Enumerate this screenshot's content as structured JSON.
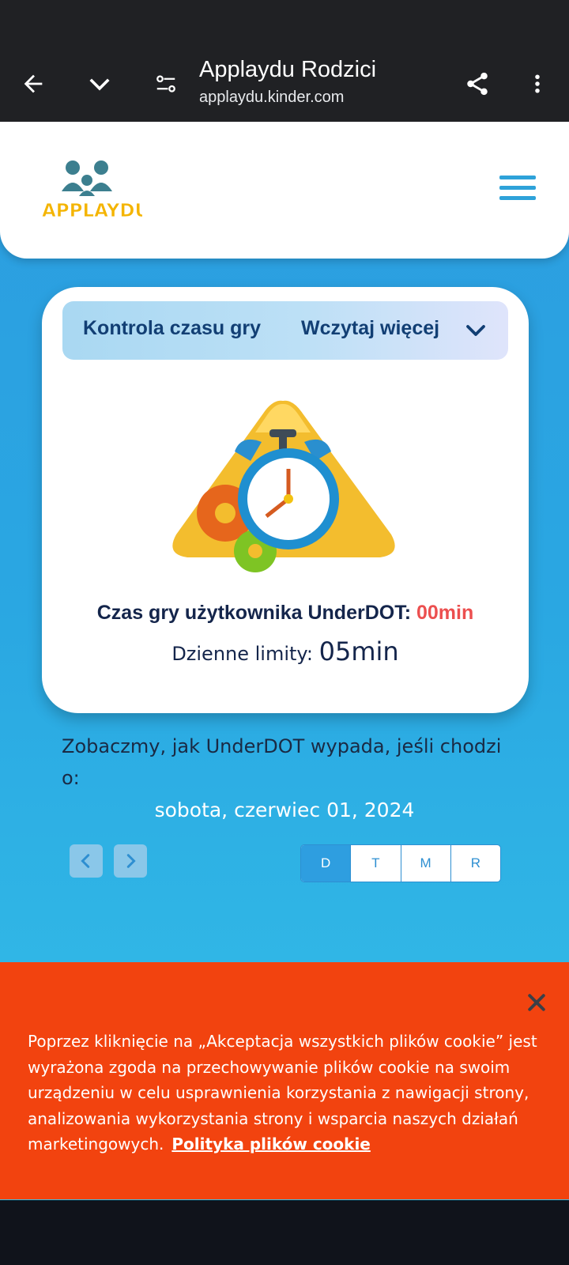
{
  "browser": {
    "title": "Applaydu Rodzici",
    "url": "applaydu.kinder.com",
    "icons": [
      "arrow-back-icon",
      "chevron-down-icon",
      "tune-icon",
      "share-icon",
      "more-vert-icon"
    ]
  },
  "header": {
    "logo_text": "APPLAYDU",
    "menu_icon": "hamburger-menu-icon"
  },
  "card": {
    "dropdown_label": "Kontrola czasu gry",
    "load_more": "Wczytaj więcej",
    "playtime_label": "Czas gry użytkownika UnderDOT: ",
    "playtime_value": "00min",
    "limit_label": "Dzienne limity: ",
    "limit_value": "05min"
  },
  "report": {
    "intro": "Zobaczmy, jak UnderDOT wypada, jeśli chodzi o:",
    "date": "sobota, czerwiec 01, 2024",
    "periods": [
      "D",
      "T",
      "M",
      "R"
    ],
    "active_period": "D"
  },
  "cookie": {
    "text": "Poprzez kliknięcie na „Akceptacja wszystkich plików cookie” jest wyrażona zgoda na przechowywanie plików cookie na swoim urządzeniu w celu usprawnienia korzystania z nawigacji strony, analizowania wykorzystania strony i wsparcia naszych działań marketingowych.",
    "link": "Polityka plików cookie"
  },
  "colors": {
    "page_blue": "#2ca3e0",
    "dark_text": "#14254b",
    "accent_red": "#ec4f4f",
    "cookie_orange": "#f2430f"
  }
}
